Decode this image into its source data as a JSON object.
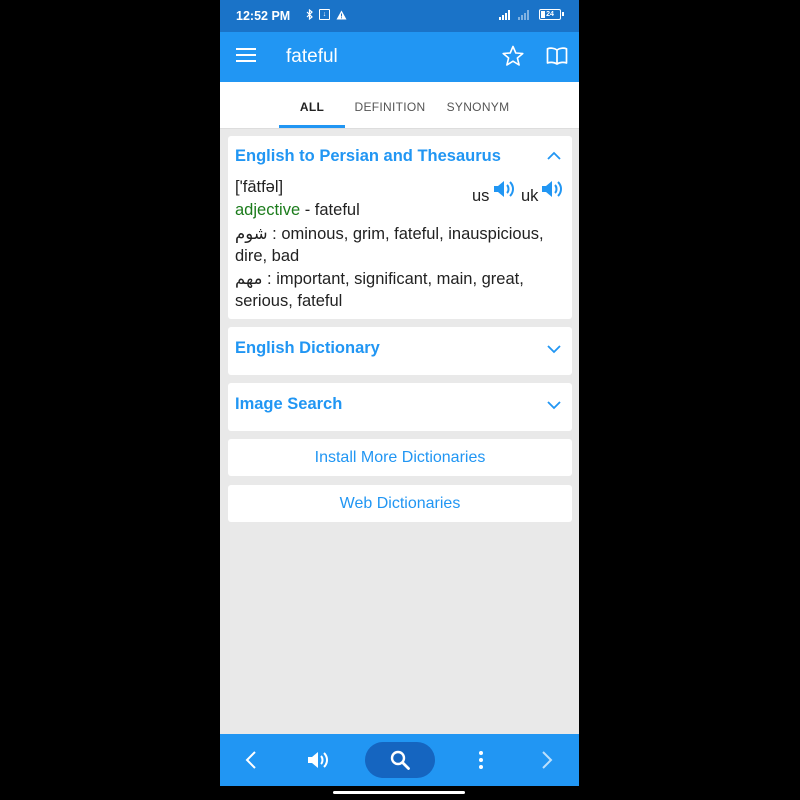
{
  "status": {
    "time": "12:52 PM",
    "battery": "24"
  },
  "appbar": {
    "title": "fateful",
    "icons": [
      "menu-icon",
      "star-icon",
      "book-icon"
    ]
  },
  "tabs": [
    {
      "label": "ALL",
      "active": true
    },
    {
      "label": "DEFINITION",
      "active": false
    },
    {
      "label": "SYNONYM",
      "active": false
    }
  ],
  "entry": {
    "section_title": "English to Persian and Thesaurus",
    "pronunciation": "['fātfəl]",
    "part_of_speech": "adjective",
    "pos_sep": " - ",
    "headword": "fateful",
    "us_label": "us",
    "uk_label": "uk",
    "sense1_term": "شوم",
    "sense1_line1": " : ominous, grim, fateful, inauspicious,",
    "sense1_line2": "dire, bad",
    "sense2_term": "مهم",
    "sense2_line1": " : important, significant, main, great,",
    "sense2_line2": "serious, fateful"
  },
  "sections": {
    "english_dictionary": "English Dictionary",
    "image_search": "Image Search"
  },
  "buttons": {
    "install_more": "Install More Dictionaries",
    "web_dictionaries": "Web Dictionaries"
  },
  "bottom_bar": {
    "icons": [
      "back-icon",
      "speaker-icon",
      "search-icon",
      "more-vert-icon",
      "forward-icon"
    ]
  },
  "colors": {
    "primary": "#2196f3",
    "status_bar": "#1a73c8",
    "part_of_speech": "#1b7b1b",
    "background": "#e9e9e9"
  }
}
